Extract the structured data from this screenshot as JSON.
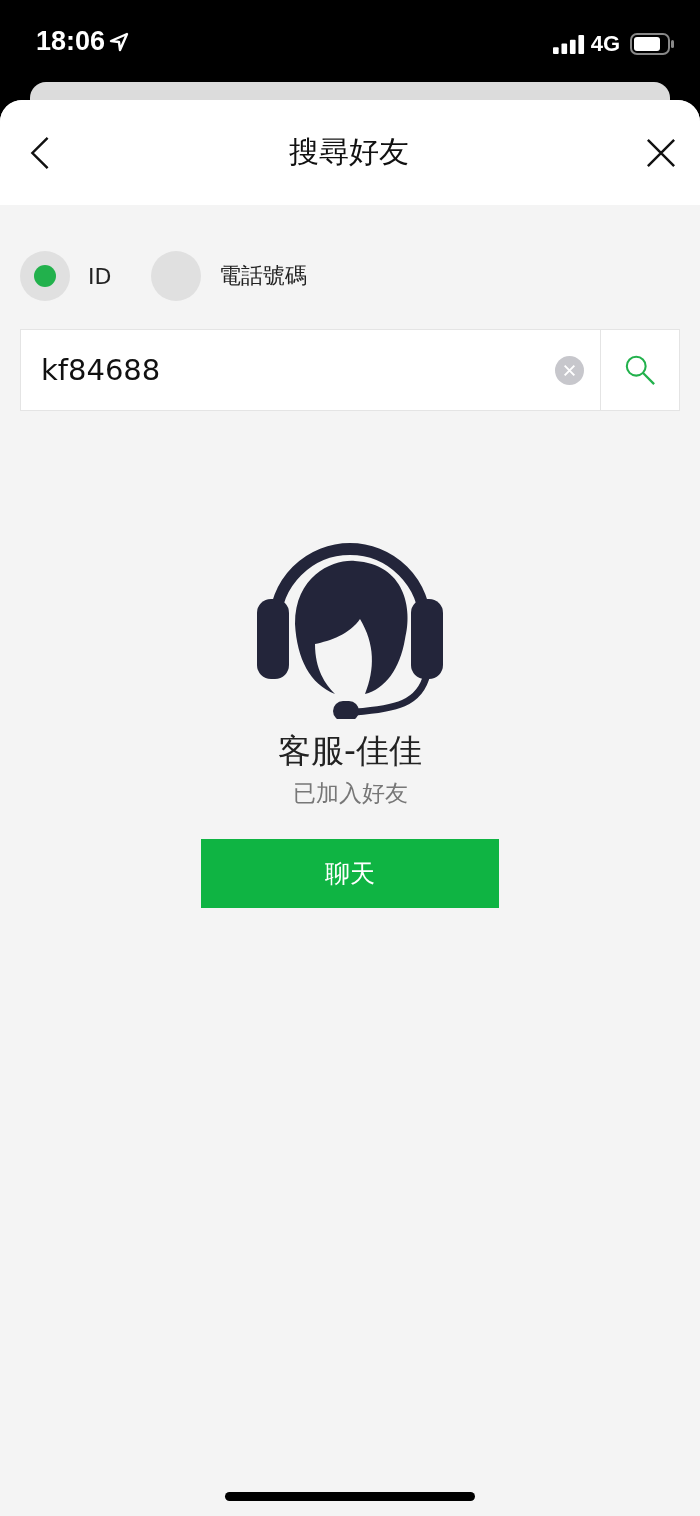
{
  "status_bar": {
    "time": "18:06",
    "network": "4G"
  },
  "header": {
    "title": "搜尋好友"
  },
  "search_types": [
    {
      "label": "ID",
      "selected": true
    },
    {
      "label": "電話號碼",
      "selected": false
    }
  ],
  "search": {
    "value": "kf84688"
  },
  "result": {
    "name": "客服-佳佳",
    "status": "已加入好友",
    "button": "聊天"
  }
}
